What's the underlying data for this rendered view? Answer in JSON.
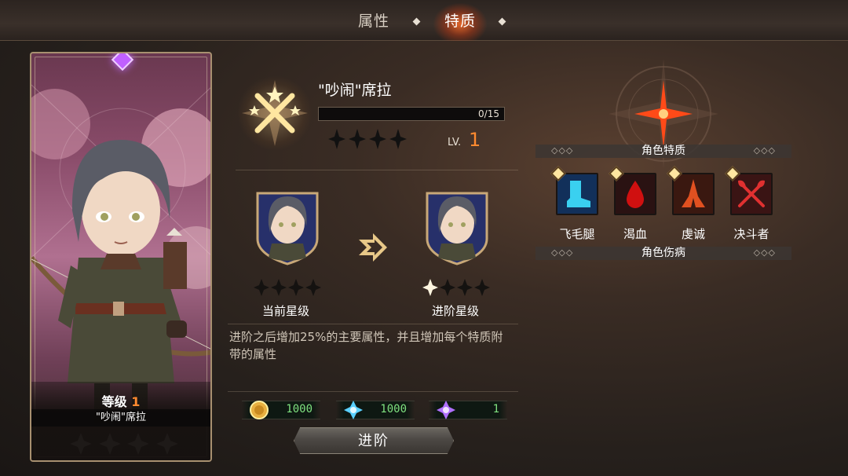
{
  "tabs": [
    {
      "label": "属性",
      "active": false
    },
    {
      "label": "特质",
      "active": true
    }
  ],
  "card": {
    "level_label": "等级",
    "level_value": "1",
    "name": "\"吵闹\"席拉",
    "stars_filled": 0,
    "stars_total": 4
  },
  "character": {
    "name": "\"吵闹\"席拉",
    "exp_text": "0/15",
    "exp_progress": 0,
    "stars_filled": 0,
    "stars_total": 4,
    "lv_label": "LV.",
    "lv_value": "1"
  },
  "advance": {
    "current_label": "当前星级",
    "current_stars_filled": 0,
    "next_label": "进阶星级",
    "next_stars_filled": 1,
    "stars_total": 4,
    "description": "进阶之后增加25%的主要属性，并且增加每个特质附带的属性",
    "button_label": "进阶"
  },
  "costs": [
    {
      "icon": "gold-coin-icon",
      "value": "1000"
    },
    {
      "icon": "blue-crystal-icon",
      "value": "1000"
    },
    {
      "icon": "purple-crystal-icon",
      "value": "1"
    }
  ],
  "traits_section": {
    "title": "角色特质",
    "dots": "◇◇◇",
    "traits": [
      {
        "label": "飞毛腿",
        "icon": "boot-icon",
        "color": "#3ad0f0"
      },
      {
        "label": "渴血",
        "icon": "blood-drop-icon",
        "color": "#d01010"
      },
      {
        "label": "虔诚",
        "icon": "praying-hands-icon",
        "color": "#e05020"
      },
      {
        "label": "决斗者",
        "icon": "crossed-axes-icon",
        "color": "#e03030"
      }
    ]
  },
  "injury_section": {
    "title": "角色伤病",
    "dots": "◇◇◇"
  },
  "colors": {
    "accent_orange": "#ff8a30",
    "cost_green": "#7fe07f"
  }
}
